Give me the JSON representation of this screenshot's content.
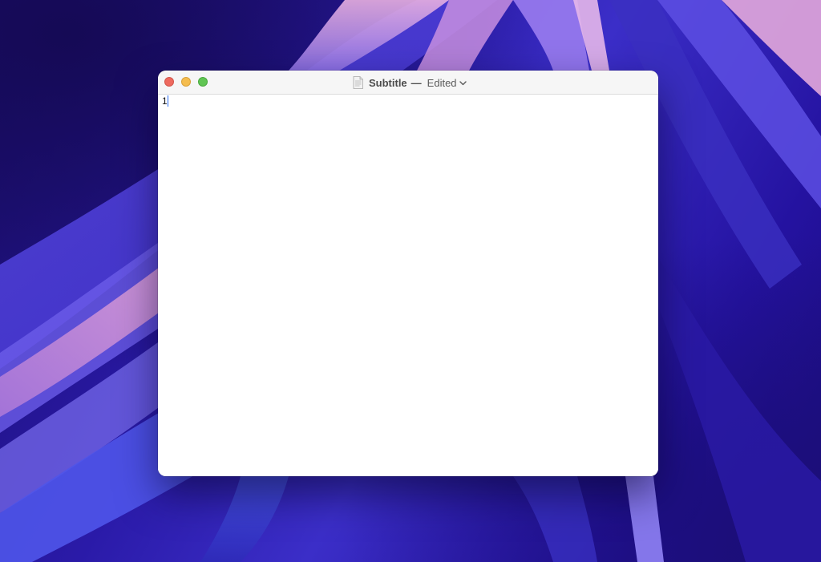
{
  "window": {
    "title": "Subtitle",
    "separator": "—",
    "status": "Edited"
  },
  "editor": {
    "content": "1"
  },
  "icons": {
    "close": "close-traffic-light",
    "minimize": "minimize-traffic-light",
    "zoom": "zoom-traffic-light",
    "document": "document-icon",
    "chevron": "chevron-down-icon"
  },
  "colors": {
    "close": "#ee6a5f",
    "minimize": "#f5bd4f",
    "zoom": "#61c554",
    "caret": "#2a6ef5"
  }
}
